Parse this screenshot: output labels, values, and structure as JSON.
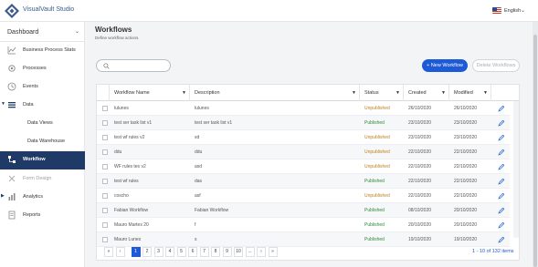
{
  "app": {
    "brand": "VisualVault Studio"
  },
  "header": {
    "language": "English"
  },
  "sidebar": {
    "dashboard_label": "Dashboard",
    "items": [
      {
        "label": "Business Process Stats",
        "icon": "chart-icon"
      },
      {
        "label": "Processes",
        "icon": "gear-icon"
      },
      {
        "label": "Events",
        "icon": "clock-icon"
      },
      {
        "label": "Data",
        "icon": "data-icon"
      },
      {
        "label": "Data Views",
        "icon": ""
      },
      {
        "label": "Data Warehouse",
        "icon": ""
      },
      {
        "label": "Workflow",
        "icon": "workflow-icon"
      },
      {
        "label": "Form Design",
        "icon": "form-design-icon"
      },
      {
        "label": "Analytics",
        "icon": "analytics-icon"
      },
      {
        "label": "Reports",
        "icon": "report-icon"
      }
    ]
  },
  "main": {
    "title": "Workflows",
    "subtitle": "Define workflow actions.",
    "search_placeholder": "",
    "new_button": "+ New Workflow",
    "delete_button": "Delete Workflows"
  },
  "table": {
    "columns": [
      "",
      "Workflow Name",
      "Description",
      "Status",
      "Created",
      "Modified",
      ""
    ],
    "rows": [
      {
        "name": "lulunes",
        "description": "lulunes",
        "status": "Unpublished",
        "created": "26/10/2020",
        "modified": "26/10/2020"
      },
      {
        "name": "test ser task list v1",
        "description": "test ser task list v1",
        "status": "Published",
        "created": "23/10/2020",
        "modified": "23/10/2020"
      },
      {
        "name": "test wf rules v2",
        "description": "sd",
        "status": "Unpublished",
        "created": "23/10/2020",
        "modified": "23/10/2020"
      },
      {
        "name": "ddu",
        "description": "ddu",
        "status": "Unpublished",
        "created": "22/10/2020",
        "modified": "22/10/2020"
      },
      {
        "name": "WF rules tes v2",
        "description": "asd",
        "status": "Unpublished",
        "created": "22/10/2020",
        "modified": "22/10/2020"
      },
      {
        "name": "test wf rules",
        "description": "das",
        "status": "Published",
        "created": "22/10/2020",
        "modified": "22/10/2020"
      },
      {
        "name": "coscho",
        "description": "asf",
        "status": "Unpublished",
        "created": "22/10/2020",
        "modified": "22/10/2020"
      },
      {
        "name": "Fabian Workflow",
        "description": "Fabian Workflow",
        "status": "Published",
        "created": "08/10/2020",
        "modified": "20/10/2020"
      },
      {
        "name": "Mauro Martes 20",
        "description": "f",
        "status": "Published",
        "created": "20/10/2020",
        "modified": "20/10/2020"
      },
      {
        "name": "Mauro Lunes",
        "description": "s",
        "status": "Published",
        "created": "19/10/2020",
        "modified": "19/10/2020"
      }
    ]
  },
  "pagination": {
    "first": "«",
    "prev": "‹",
    "pages": [
      "1",
      "2",
      "3",
      "4",
      "5",
      "6",
      "7",
      "8",
      "9",
      "10",
      "..."
    ],
    "current": "1",
    "next": "›",
    "last": "»",
    "info": "1 - 10 of 132 items"
  },
  "colors": {
    "primary": "#1c5ad6",
    "sidebar_active": "#1f3a66",
    "published": "#2e8b3e",
    "unpublished": "#c0821a"
  }
}
